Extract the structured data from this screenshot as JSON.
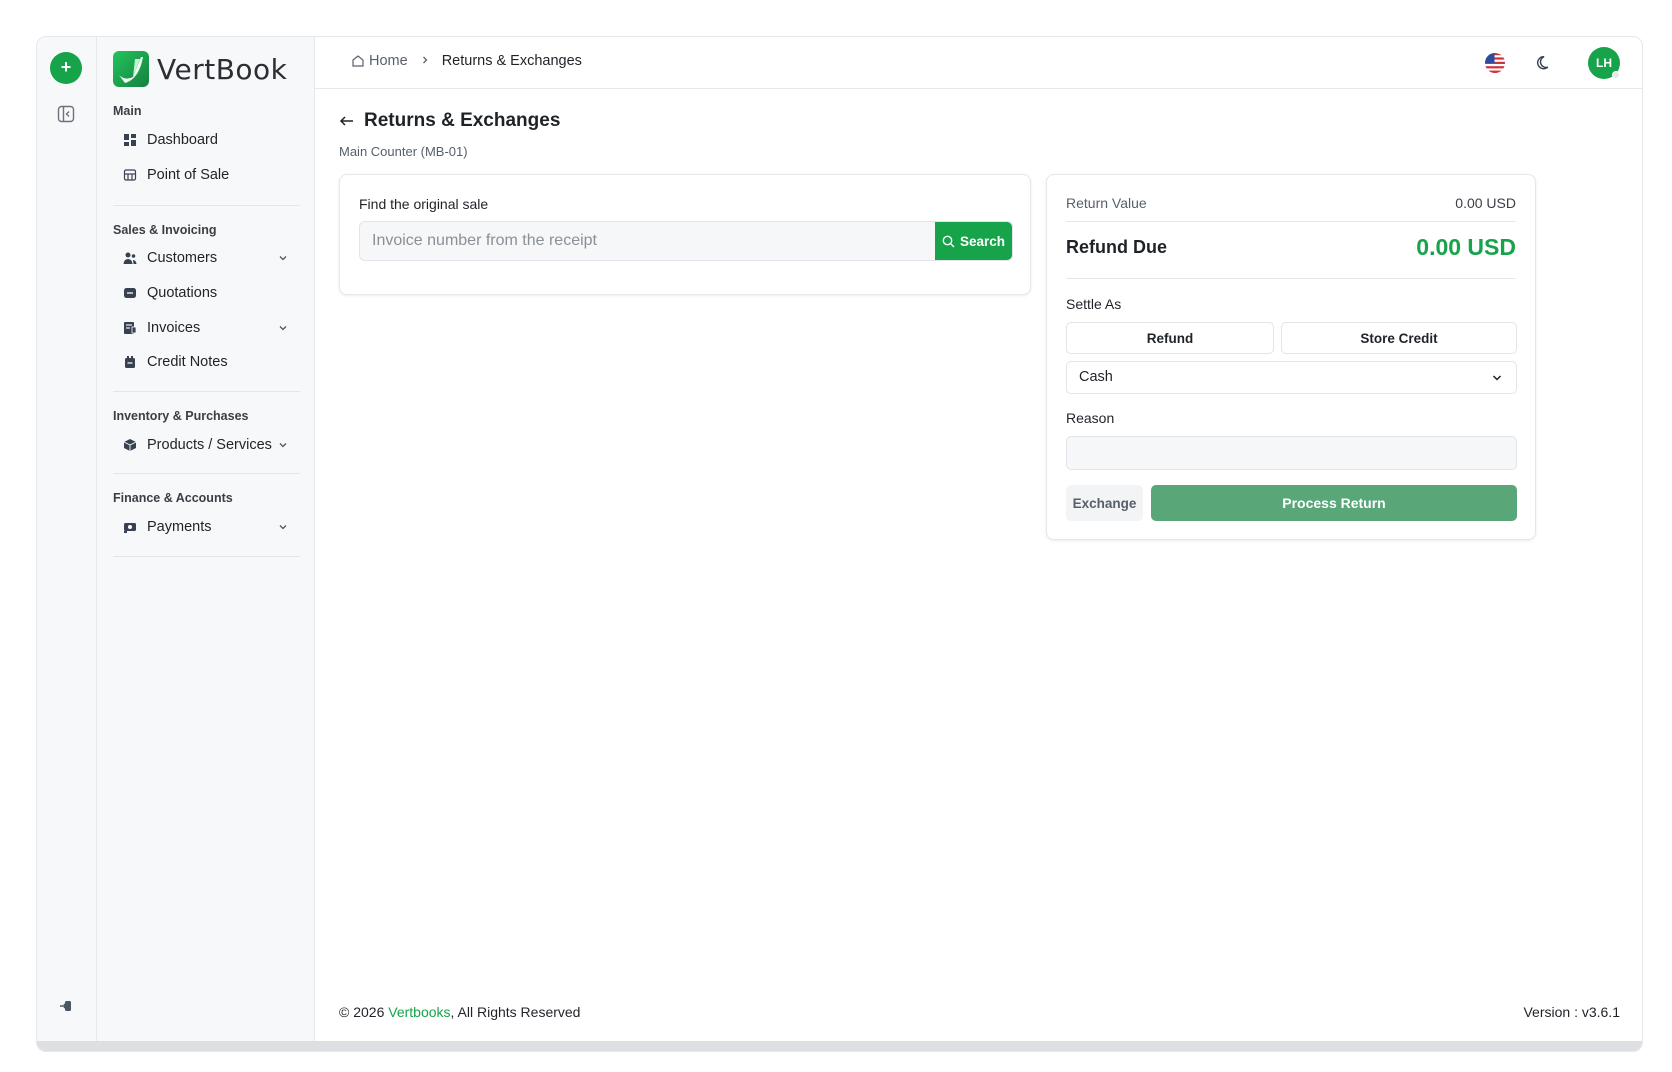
{
  "sidebar": {
    "brand": "VertBook",
    "sections": [
      {
        "title": "Main",
        "items": [
          {
            "label": "Dashboard",
            "icon": "dashboard-icon"
          },
          {
            "label": "Point of Sale",
            "icon": "pos-icon"
          }
        ]
      },
      {
        "title": "Sales & Invoicing",
        "items": [
          {
            "label": "Customers",
            "icon": "customers-icon"
          },
          {
            "label": "Quotations",
            "icon": "quotations-icon"
          },
          {
            "label": "Invoices",
            "icon": "invoices-icon"
          },
          {
            "label": "Credit Notes",
            "icon": "credit-notes-icon"
          }
        ]
      },
      {
        "title": "Inventory & Purchases",
        "items": [
          {
            "label": "Products / Services",
            "icon": "products-icon"
          }
        ]
      },
      {
        "title": "Finance & Accounts",
        "items": [
          {
            "label": "Payments",
            "icon": "payments-icon"
          }
        ]
      }
    ]
  },
  "header": {
    "breadcrumb_home": "Home",
    "breadcrumb_current": "Returns & Exchanges",
    "avatar_initials": "LH"
  },
  "page": {
    "title": "Returns & Exchanges",
    "subtitle": "Main Counter (MB-01)"
  },
  "search_card": {
    "label": "Find the original sale",
    "placeholder": "Invoice number from the receipt",
    "button": "Search"
  },
  "summary": {
    "return_value_label": "Return Value",
    "return_value": "0.00 USD",
    "refund_due_label": "Refund Due",
    "refund_due": "0.00 USD",
    "settle_as_label": "Settle As",
    "option_refund": "Refund",
    "option_store_credit": "Store Credit",
    "method_selected": "Cash",
    "reason_label": "Reason",
    "exchange_button": "Exchange",
    "process_button": "Process Return"
  },
  "footer": {
    "copyright_prefix": "© 2026 ",
    "brand": "Vertbooks",
    "copyright_suffix": ", All Rights Reserved",
    "version": "Version : v3.6.1"
  },
  "colors": {
    "accent": "#16a34a",
    "process_button": "#59a679"
  }
}
